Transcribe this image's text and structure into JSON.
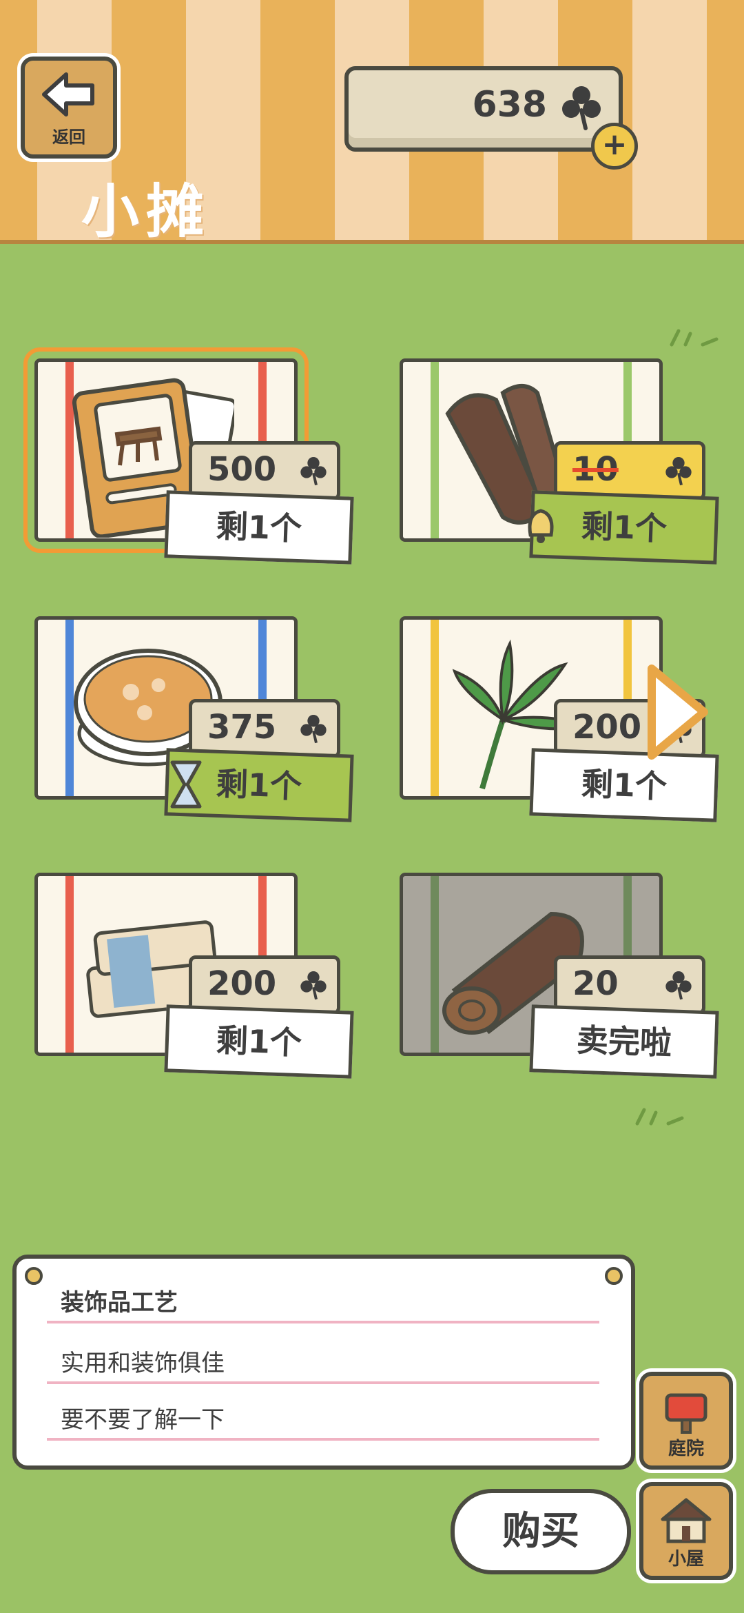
{
  "header": {
    "back_label": "返回",
    "stall_title": "小摊",
    "clover_count": "638"
  },
  "items": [
    {
      "name": "木椅图纸",
      "price": "500",
      "stock": "剩1个",
      "selected": true
    },
    {
      "name": "木材",
      "price": "10",
      "stock": "剩1个",
      "on_sale": true
    },
    {
      "name": "汤",
      "price": "375",
      "stock": "剩1个",
      "limited": true
    },
    {
      "name": "棕榈叶",
      "price": "200",
      "stock": "剩1个"
    },
    {
      "name": "布料",
      "price": "200",
      "stock": "剩1个"
    },
    {
      "name": "原木",
      "price": "20",
      "stock": "卖完啦"
    }
  ],
  "message": {
    "line1": "装饰品工艺",
    "line2": "实用和装饰俱佳",
    "line3": "要不要了解一下"
  },
  "side_buttons": {
    "yard_label": "庭院",
    "house_label": "小屋"
  },
  "buy_label": "购买",
  "colors": {
    "background": "#9bc265",
    "header_stripe_dark": "#e9b25a",
    "header_stripe_light": "#f5d6ad",
    "selection": "#f39b35",
    "sale_tag": "#f3d14f",
    "highlight_tag": "#a7c551"
  },
  "icons": [
    "back-arrow-icon",
    "clover-icon",
    "plus-icon",
    "bell-icon",
    "hourglass-icon",
    "right-arrow-icon",
    "mailbox-icon",
    "house-icon"
  ]
}
